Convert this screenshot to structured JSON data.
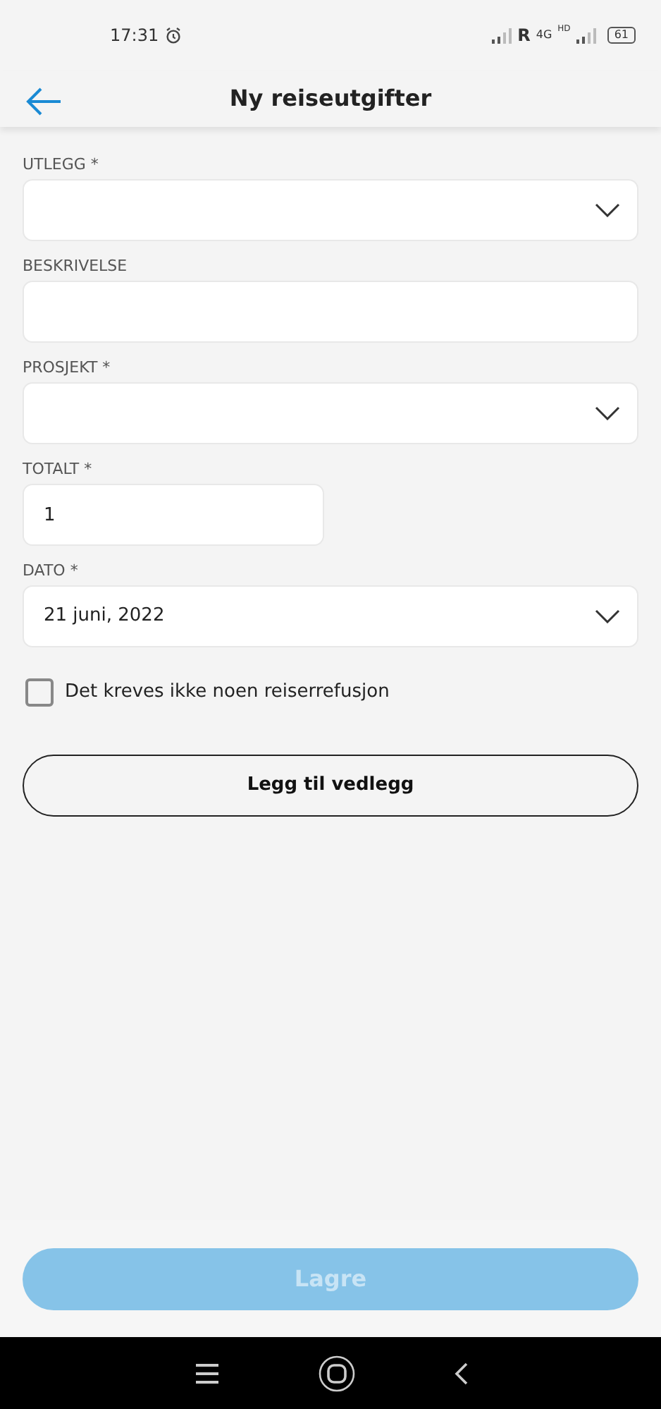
{
  "status_bar": {
    "time": "17:31",
    "carrier": "R",
    "network": "4G",
    "hd": "HD",
    "battery": "61"
  },
  "header": {
    "title": "Ny reiseutgifter"
  },
  "fields": [
    {
      "kind": "select",
      "label": "UTLEGG *",
      "half": false
    },
    {
      "kind": "text",
      "label": "BESKRIVELSE",
      "half": false
    },
    {
      "kind": "select",
      "label": "PROSJEKT *",
      "half": false
    },
    {
      "kind": "text",
      "label": "TOTALT *",
      "value": "1",
      "half": true
    },
    {
      "kind": "select",
      "label": "DATO *",
      "value": "21 juni, 2022",
      "half": false
    }
  ],
  "checkbox": {
    "label": "Det kreves ikke noen reiserrefusjon",
    "checked": false
  },
  "attach_button": {
    "label": "Legg til vedlegg"
  },
  "save_button": {
    "label": "Lagre",
    "disabled": true
  }
}
